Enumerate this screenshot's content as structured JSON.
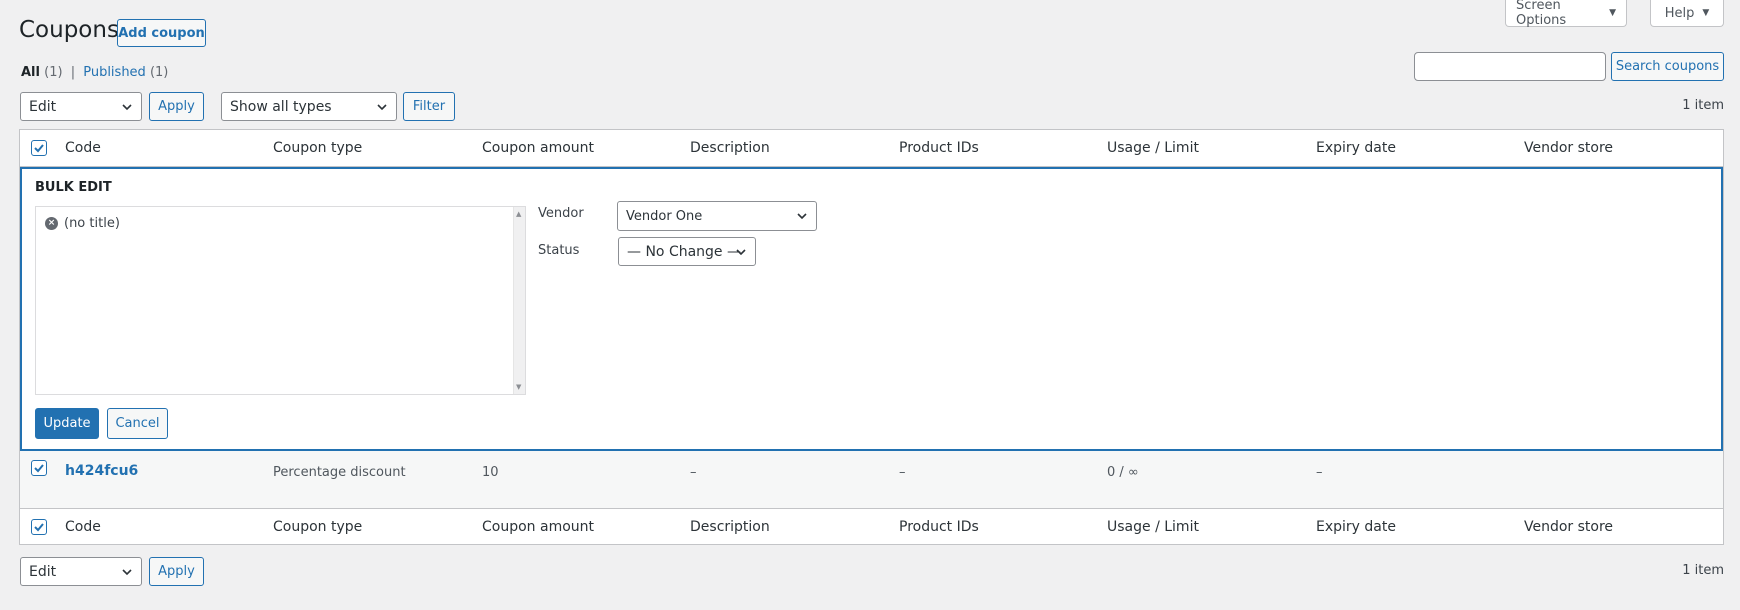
{
  "header": {
    "title": "Coupons",
    "add_button": "Add coupon",
    "screen_options": "Screen Options",
    "help": "Help"
  },
  "views": {
    "all_label": "All",
    "all_count": "(1)",
    "separator": "|",
    "published_label": "Published",
    "published_count": "(1)"
  },
  "search": {
    "placeholder": "",
    "button": "Search coupons"
  },
  "top_nav": {
    "bulk_action": "Edit",
    "apply": "Apply",
    "type_filter": "Show all types",
    "filter": "Filter",
    "count": "1 item"
  },
  "table": {
    "columns": [
      "Code",
      "Coupon type",
      "Coupon amount",
      "Description",
      "Product IDs",
      "Usage / Limit",
      "Expiry date",
      "Vendor store"
    ]
  },
  "bulk_edit": {
    "title": "BULK EDIT",
    "items": [
      "(no title)"
    ],
    "vendor_label": "Vendor",
    "vendor_value": "Vendor One",
    "status_label": "Status",
    "status_value": "— No Change —",
    "update": "Update",
    "cancel": "Cancel"
  },
  "rows": [
    {
      "code": "h424fcu6",
      "coupon_type": "Percentage discount",
      "amount": "10",
      "description": "–",
      "product_ids": "–",
      "usage": "0 / ∞",
      "expiry": "–",
      "vendor_store": ""
    }
  ],
  "bottom_nav": {
    "bulk_action": "Edit",
    "apply": "Apply",
    "count": "1 item"
  },
  "colors": {
    "accent": "#2271b1",
    "background": "#f0f0f1"
  }
}
